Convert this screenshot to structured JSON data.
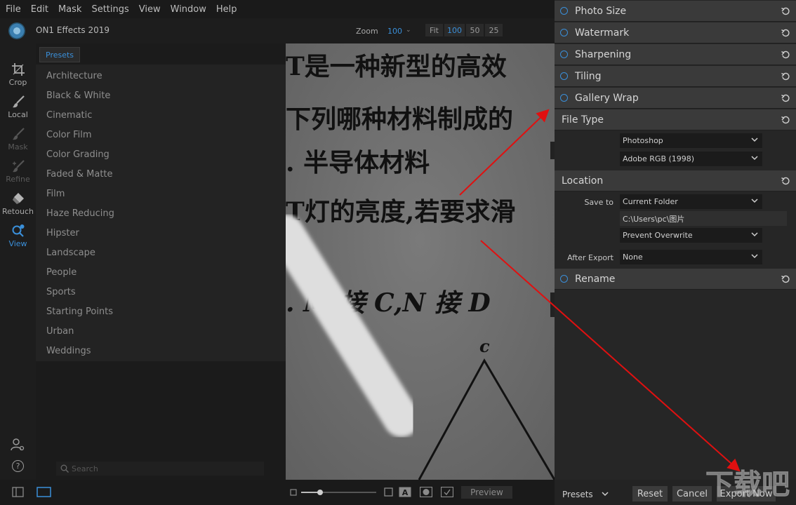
{
  "menu": [
    "File",
    "Edit",
    "Mask",
    "Settings",
    "View",
    "Window",
    "Help"
  ],
  "app": {
    "title": "ON1 Effects 2019",
    "accent": "#3a8fd9"
  },
  "zoom": {
    "label": "Zoom",
    "value": "100",
    "buttons": [
      "Fit",
      "100",
      "50",
      "25"
    ],
    "active": "100"
  },
  "tools": [
    {
      "label": "Crop",
      "icon": "crop-icon",
      "state": "normal"
    },
    {
      "label": "Local",
      "icon": "brush-icon",
      "state": "normal"
    },
    {
      "label": "Mask",
      "icon": "mask-brush-icon",
      "state": "dim"
    },
    {
      "label": "Refine",
      "icon": "refine-brush-icon",
      "state": "dim"
    },
    {
      "label": "Retouch",
      "icon": "retouch-icon",
      "state": "normal"
    },
    {
      "label": "View",
      "icon": "view-icon",
      "state": "active"
    }
  ],
  "presets": {
    "tab": "Presets",
    "items": [
      "Architecture",
      "Black & White",
      "Cinematic",
      "Color Film",
      "Color Grading",
      "Faded & Matte",
      "Film",
      "Haze Reducing",
      "Hipster",
      "Landscape",
      "People",
      "Sports",
      "Starting Points",
      "Urban",
      "Weddings"
    ],
    "search_placeholder": "Search"
  },
  "photo": {
    "lines": [
      "T是一种新型的高效",
      "下列哪种材料制成的",
      ". 半导体材料",
      "T灯的亮度,若要求滑",
      ". M 接 C,N 接 D",
      "c"
    ]
  },
  "bottom": {
    "preview": "Preview"
  },
  "export": {
    "collapsed_sections": [
      "Photo Size",
      "Watermark",
      "Sharpening",
      "Tiling",
      "Gallery Wrap"
    ],
    "file_type": {
      "title": "File Type",
      "format": "Photoshop",
      "color_space": "Adobe RGB (1998)"
    },
    "location": {
      "title": "Location",
      "save_to_label": "Save to",
      "save_to": "Current Folder",
      "path": "C:\\Users\\pc\\图片",
      "overwrite": "Prevent Overwrite",
      "after_export_label": "After Export",
      "after_export": "None"
    },
    "rename": {
      "title": "Rename"
    }
  },
  "footer": {
    "presets": "Presets",
    "reset": "Reset",
    "cancel": "Cancel",
    "export": "Export Now"
  },
  "watermark": {
    "text": "下载吧"
  }
}
